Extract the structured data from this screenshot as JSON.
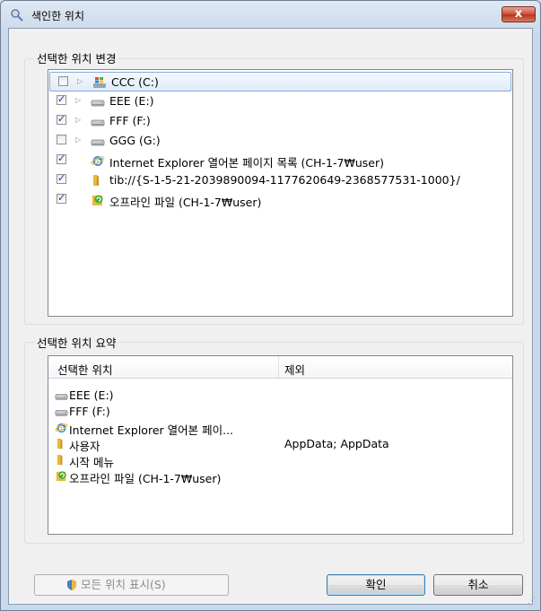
{
  "window": {
    "title": "색인한 위치",
    "close_label": "x"
  },
  "change_group": {
    "label": "선택한 위치 변경",
    "items": [
      {
        "label": "CCC (C:)",
        "checked": false,
        "expandable": true,
        "icon": "windows-drive-icon",
        "selected": true
      },
      {
        "label": "EEE (E:)",
        "checked": true,
        "expandable": true,
        "icon": "drive-icon",
        "selected": false
      },
      {
        "label": "FFF (F:)",
        "checked": true,
        "expandable": true,
        "icon": "drive-icon",
        "selected": false
      },
      {
        "label": "GGG (G:)",
        "checked": false,
        "expandable": true,
        "icon": "drive-icon",
        "selected": false
      },
      {
        "label": "Internet Explorer 열어본 페이지 목록 (CH-1-7₩user)",
        "checked": true,
        "expandable": false,
        "icon": "ie-icon",
        "selected": false
      },
      {
        "label": "tib://{S-1-5-21-2039890094-1177620649-2368577531-1000}/",
        "checked": true,
        "expandable": false,
        "icon": "folder-icon",
        "selected": false
      },
      {
        "label": "오프라인 파일 (CH-1-7₩user)",
        "checked": true,
        "expandable": false,
        "icon": "offline-files-icon",
        "selected": false
      }
    ]
  },
  "summary_group": {
    "label": "선택한 위치 요약",
    "columns": [
      "선택한 위치",
      "제외"
    ],
    "rows": [
      {
        "location": "EEE (E:)",
        "exclude": "",
        "icon": "drive-icon"
      },
      {
        "location": "FFF (F:)",
        "exclude": "",
        "icon": "drive-icon"
      },
      {
        "location": "Internet Explorer 열어본 페이...",
        "exclude": "",
        "icon": "ie-icon"
      },
      {
        "location": "사용자",
        "exclude": "AppData; AppData",
        "icon": "folder-icon"
      },
      {
        "location": "시작 메뉴",
        "exclude": "",
        "icon": "folder-icon"
      },
      {
        "location": "오프라인 파일 (CH-1-7₩user)",
        "exclude": "",
        "icon": "offline-files-icon"
      }
    ]
  },
  "buttons": {
    "show_all": "모든 위치 표시(S)",
    "ok": "확인",
    "cancel": "취소"
  },
  "colors": {
    "accent": "#3c7fb1",
    "close": "#c9503a",
    "folder": "#e8b93a"
  }
}
